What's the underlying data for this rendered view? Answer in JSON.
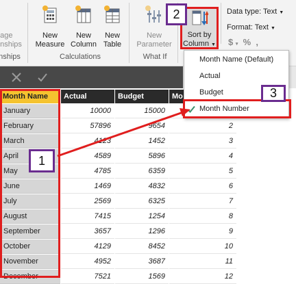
{
  "ribbon": {
    "left_partial": {
      "line1": "nage",
      "line2": "onships"
    },
    "left_group_label": "onships",
    "new_measure": {
      "line1": "New",
      "line2": "Measure"
    },
    "new_column": {
      "line1": "New",
      "line2": "Column"
    },
    "new_table": {
      "line1": "New",
      "line2": "Table"
    },
    "calculations_label": "Calculations",
    "new_parameter": {
      "line1": "New",
      "line2": "Parameter"
    },
    "whatif_label": "What If",
    "sort_by_column": {
      "line1": "Sort by",
      "line2": "Column"
    },
    "data_type": "Data type: Text",
    "format": "Format: Text",
    "format_symbols": [
      "$",
      "%",
      ",",
      ".00"
    ]
  },
  "table": {
    "headers": [
      "Month Name",
      "Actual",
      "Budget",
      "Mo"
    ],
    "rows": [
      [
        "January",
        "10000",
        "15000",
        "1"
      ],
      [
        "February",
        "57896",
        "9654",
        "2"
      ],
      [
        "March",
        "4123",
        "1452",
        "3"
      ],
      [
        "April",
        "4589",
        "5896",
        "4"
      ],
      [
        "May",
        "4785",
        "6359",
        "5"
      ],
      [
        "June",
        "1469",
        "4832",
        "6"
      ],
      [
        "July",
        "2569",
        "6325",
        "7"
      ],
      [
        "August",
        "7415",
        "1254",
        "8"
      ],
      [
        "September",
        "3657",
        "1296",
        "9"
      ],
      [
        "October",
        "4129",
        "8452",
        "10"
      ],
      [
        "November",
        "4952",
        "3687",
        "11"
      ],
      [
        "December",
        "7521",
        "1569",
        "12"
      ]
    ]
  },
  "dropdown": {
    "items": [
      {
        "label": "Month Name (Default)",
        "checked": false
      },
      {
        "label": "Actual",
        "checked": false
      },
      {
        "label": "Budget",
        "checked": false
      },
      {
        "label": "Month Number",
        "checked": true
      }
    ]
  },
  "annotations": {
    "badge1": "1",
    "badge2": "2",
    "badge3": "3"
  },
  "colors": {
    "annotation_red": "#e01e1e",
    "badge_border": "#6a2c8f",
    "selected_header": "#f5c32f"
  }
}
